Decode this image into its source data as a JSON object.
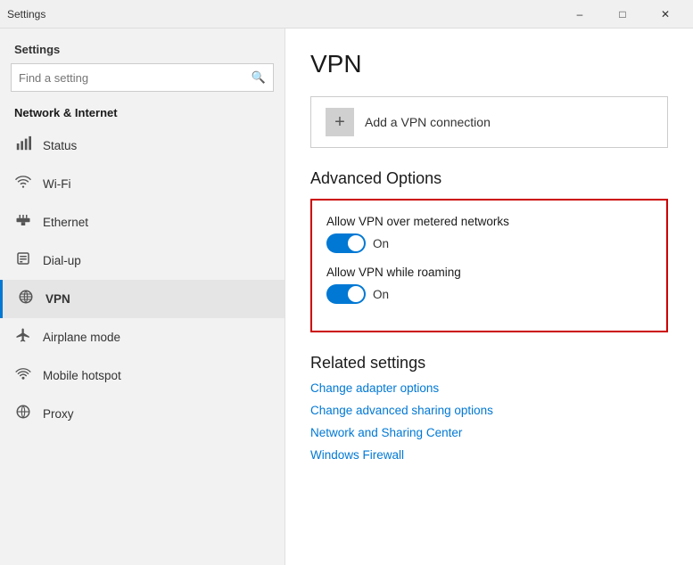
{
  "titleBar": {
    "title": "Settings",
    "minimize": "–",
    "maximize": "□",
    "close": "✕"
  },
  "sidebar": {
    "header": "Settings",
    "search": {
      "placeholder": "Find a setting",
      "icon": "🔍"
    },
    "sectionLabel": "Network & Internet",
    "items": [
      {
        "id": "status",
        "icon": "⌂",
        "label": "Status",
        "active": false
      },
      {
        "id": "wifi",
        "icon": "wireless",
        "label": "Wi-Fi",
        "active": false
      },
      {
        "id": "ethernet",
        "icon": "ethernet",
        "label": "Ethernet",
        "active": false
      },
      {
        "id": "dialup",
        "icon": "dialup",
        "label": "Dial-up",
        "active": false
      },
      {
        "id": "vpn",
        "icon": "vpn",
        "label": "VPN",
        "active": true
      },
      {
        "id": "airplane",
        "icon": "airplane",
        "label": "Airplane mode",
        "active": false
      },
      {
        "id": "hotspot",
        "icon": "hotspot",
        "label": "Mobile hotspot",
        "active": false
      },
      {
        "id": "proxy",
        "icon": "proxy",
        "label": "Proxy",
        "active": false
      }
    ]
  },
  "main": {
    "pageTitle": "VPN",
    "addVPN": {
      "label": "Add a VPN connection",
      "plusIcon": "+"
    },
    "advancedOptions": {
      "title": "Advanced Options",
      "toggles": [
        {
          "label": "Allow VPN over metered networks",
          "state": "On",
          "on": true
        },
        {
          "label": "Allow VPN while roaming",
          "state": "On",
          "on": true
        }
      ]
    },
    "relatedSettings": {
      "title": "Related settings",
      "links": [
        "Change adapter options",
        "Change advanced sharing options",
        "Network and Sharing Center",
        "Windows Firewall"
      ]
    }
  }
}
